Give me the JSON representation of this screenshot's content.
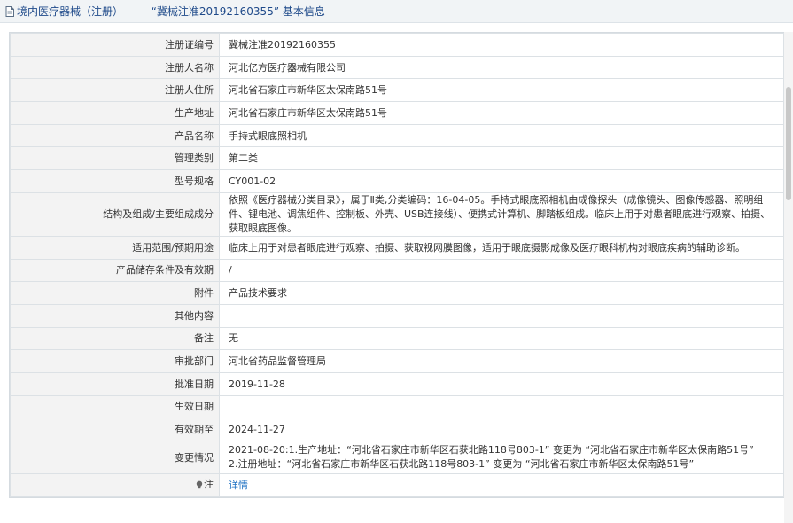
{
  "header": {
    "title": "境内医疗器械（注册） —— “冀械注准20192160355” 基本信息",
    "icon": "document-icon"
  },
  "rows": [
    {
      "label": "注册证编号",
      "value": "冀械注准20192160355"
    },
    {
      "label": "注册人名称",
      "value": "河北亿方医疗器械有限公司"
    },
    {
      "label": "注册人住所",
      "value": "河北省石家庄市新华区太保南路51号"
    },
    {
      "label": "生产地址",
      "value": "河北省石家庄市新华区太保南路51号"
    },
    {
      "label": "产品名称",
      "value": "手持式眼底照相机"
    },
    {
      "label": "管理类别",
      "value": "第二类"
    },
    {
      "label": "型号规格",
      "value": "CY001-02"
    },
    {
      "label": "结构及组成/主要组成成分",
      "value": "依照《医疗器械分类目录》，属于Ⅱ类,分类编码：16-04-05。手持式眼底照相机由成像探头（成像镜头、图像传感器、照明组件、锂电池、调焦组件、控制板、外壳、USB连接线）、便携式计算机、脚踏板组成。临床上用于对患者眼底进行观察、拍摄、获取眼底图像。"
    },
    {
      "label": "适用范围/预期用途",
      "value": "临床上用于对患者眼底进行观察、拍摄、获取视网膜图像，适用于眼底摄影成像及医疗眼科机构对眼底疾病的辅助诊断。"
    },
    {
      "label": "产品储存条件及有效期",
      "value": "/"
    },
    {
      "label": "附件",
      "value": "产品技术要求"
    },
    {
      "label": "其他内容",
      "value": ""
    },
    {
      "label": "备注",
      "value": "无"
    },
    {
      "label": "审批部门",
      "value": "河北省药品监督管理局"
    },
    {
      "label": "批准日期",
      "value": "2019-11-28"
    },
    {
      "label": "生效日期",
      "value": ""
    },
    {
      "label": "有效期至",
      "value": "2024-11-27"
    },
    {
      "label": "变更情况",
      "value_line1": "2021-08-20:1.生产地址：“河北省石家庄市新华区石获北路118号803-1” 变更为 “河北省石家庄市新华区太保南路51号”",
      "value_line2": "2.注册地址：“河北省石家庄市新华区石获北路118号803-1” 变更为 “河北省石家庄市新华区太保南路51号”"
    },
    {
      "label": "注",
      "value": "详情",
      "icon": "lightbulb-icon"
    }
  ]
}
